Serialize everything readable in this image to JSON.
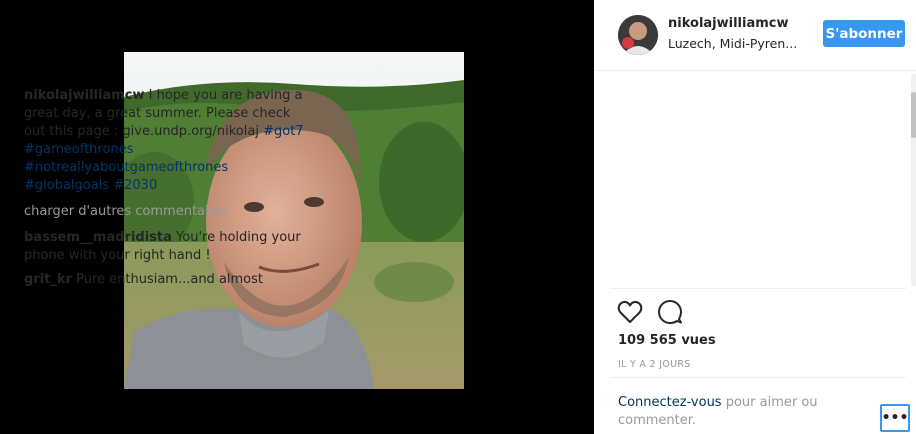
{
  "post": {
    "username": "nikolajwilliamcw",
    "location": "Luzech, Midi-Pyren...",
    "follow_label": "S'abonner"
  },
  "caption": {
    "username": "nikolajwilliamcw",
    "text": " I hope you are having a great day, a great summer. Please check out this page : give.undp.org/nikolaj ",
    "hashtags": [
      "#got7",
      "#gameofthrones",
      "#notreallyaboutgameofthrones",
      "#globalgoals",
      "#2030"
    ]
  },
  "load_more_label": "charger d'autres commentaires",
  "comments": [
    {
      "username": "bassem__madridista",
      "text": " You're holding your phone with your right hand !"
    },
    {
      "username": "grit_kr",
      "text": " Pure enthusiam...and almost"
    }
  ],
  "views": "109 565 vues",
  "time": "IL Y A 2 JOURS",
  "login": {
    "link": "Connectez-vous",
    "text": " pour aimer ou commenter."
  },
  "more_label": "•••",
  "icons": {
    "like": "heart-icon",
    "comment": "comment-icon",
    "more": "more-options-icon"
  },
  "colors": {
    "accent": "#3897f0",
    "link": "#003569",
    "muted": "#999999"
  }
}
